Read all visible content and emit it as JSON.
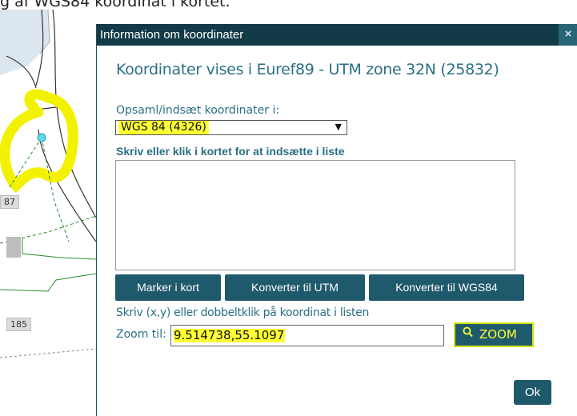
{
  "page_caption": "g af WGS84 koordinat i kortet.",
  "map": {
    "labels": [
      "87",
      "185"
    ]
  },
  "dialog": {
    "title": "Information om koordinater",
    "close_glyph": "×",
    "headline": "Koordinater vises i Euref89 - UTM zone 32N (25832)",
    "select_label": "Opsaml/indsæt koordinater i:",
    "select_value": "WGS 84 (4326)",
    "select_arrow": "▼",
    "list_label": "Skriv eller klik i kortet for at indsætte i liste",
    "buttons": {
      "mark": "Marker i kort",
      "to_utm": "Konverter til UTM",
      "to_wgs84": "Konverter til WGS84"
    },
    "hint": "Skriv (x,y) eller dobbeltklik på koordinat i listen",
    "zoom_label": "Zoom til:",
    "zoom_value": "9.514738,55.1097",
    "zoom_button": "ZOOM",
    "ok_button": "Ok"
  },
  "colors": {
    "header": "#123b47",
    "button": "#1f5a6c",
    "text_teal": "#2a6f85",
    "highlight": "#ffff33"
  }
}
